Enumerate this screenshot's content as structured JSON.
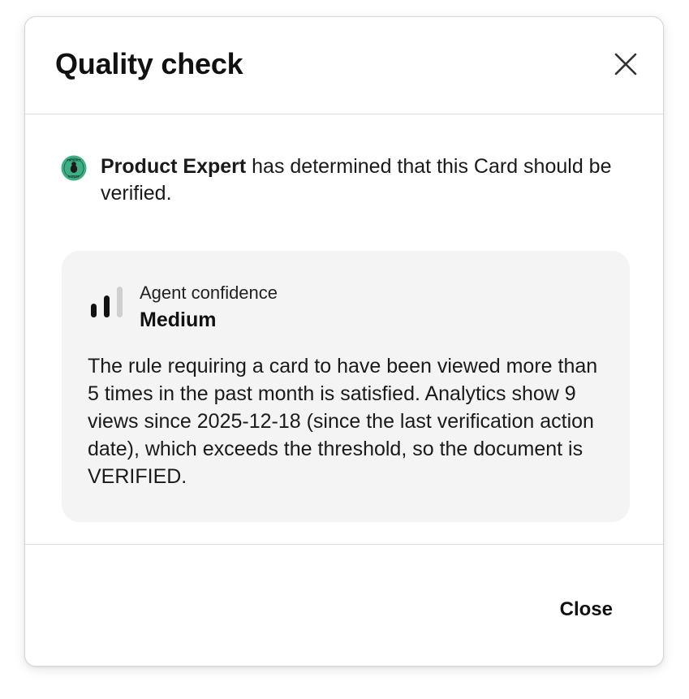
{
  "dialog": {
    "title": "Quality check",
    "close_icon": "close-icon"
  },
  "expert": {
    "avatar_icon": "product-expert-badge-icon",
    "avatar_text_top": "PRODUCT",
    "avatar_text_bottom": "EXPERT",
    "name": "Product Expert",
    "message": " has determined that this Card should be verified."
  },
  "confidence": {
    "icon": "signal-bars-icon",
    "label": "Agent confidence",
    "value": "Medium",
    "level": 2,
    "max_level": 3
  },
  "reasoning": "The rule requiring a card to have been viewed more than 5 times in the past month is satisfied. Analytics show 9 views since 2025-12-18 (since the last verification action date), which exceeds the threshold, so the document is VERIFIED.",
  "footer": {
    "close_label": "Close"
  },
  "colors": {
    "avatar_green": "#3fae84",
    "card_background": "#f4f4f4",
    "divider": "#dcdcdc"
  }
}
